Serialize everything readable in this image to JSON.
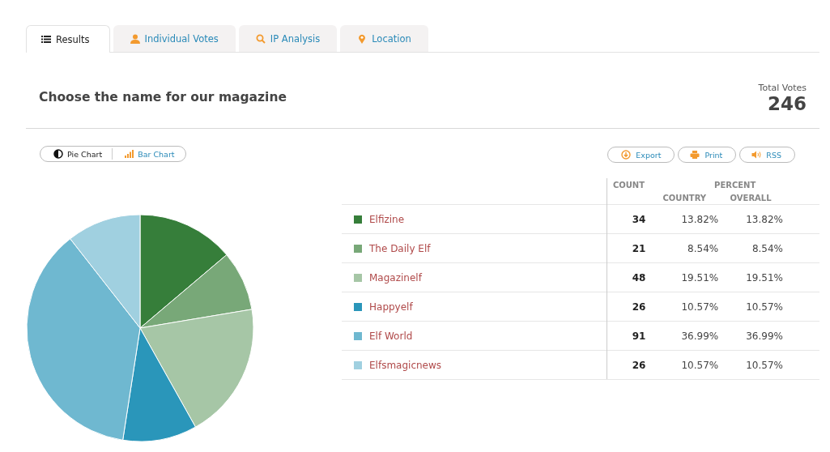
{
  "tabs": [
    {
      "label": "Results",
      "selected": true
    },
    {
      "label": "Individual Votes",
      "selected": false
    },
    {
      "label": "IP Analysis",
      "selected": false
    },
    {
      "label": "Location",
      "selected": false
    }
  ],
  "poll": {
    "title": "Choose the name for our magazine",
    "total_label": "Total Votes",
    "total": "246"
  },
  "chart_toggle": [
    {
      "label": "Pie Chart",
      "selected": true
    },
    {
      "label": "Bar Chart",
      "selected": false
    }
  ],
  "actions": [
    {
      "label": "Export"
    },
    {
      "label": "Print"
    },
    {
      "label": "RSS"
    }
  ],
  "table": {
    "columns": {
      "count": "COUNT",
      "percent": "PERCENT",
      "country": "COUNTRY",
      "overall": "OVERALL"
    },
    "rows": [
      {
        "name": "Elfizine",
        "color": "#367e3a",
        "count": "34",
        "country": "13.82%",
        "overall": "13.82%"
      },
      {
        "name": "The Daily Elf",
        "color": "#78a878",
        "count": "21",
        "country": "8.54%",
        "overall": "8.54%"
      },
      {
        "name": "Magazinelf",
        "color": "#a6c6a6",
        "count": "48",
        "country": "19.51%",
        "overall": "19.51%"
      },
      {
        "name": "Happyelf",
        "color": "#2a96ba",
        "count": "26",
        "country": "10.57%",
        "overall": "10.57%"
      },
      {
        "name": "Elf World",
        "color": "#6fb8d0",
        "count": "91",
        "country": "36.99%",
        "overall": "36.99%"
      },
      {
        "name": "Elfsmagicnews",
        "color": "#a0d0e0",
        "count": "26",
        "country": "10.57%",
        "overall": "10.57%"
      }
    ]
  }
}
